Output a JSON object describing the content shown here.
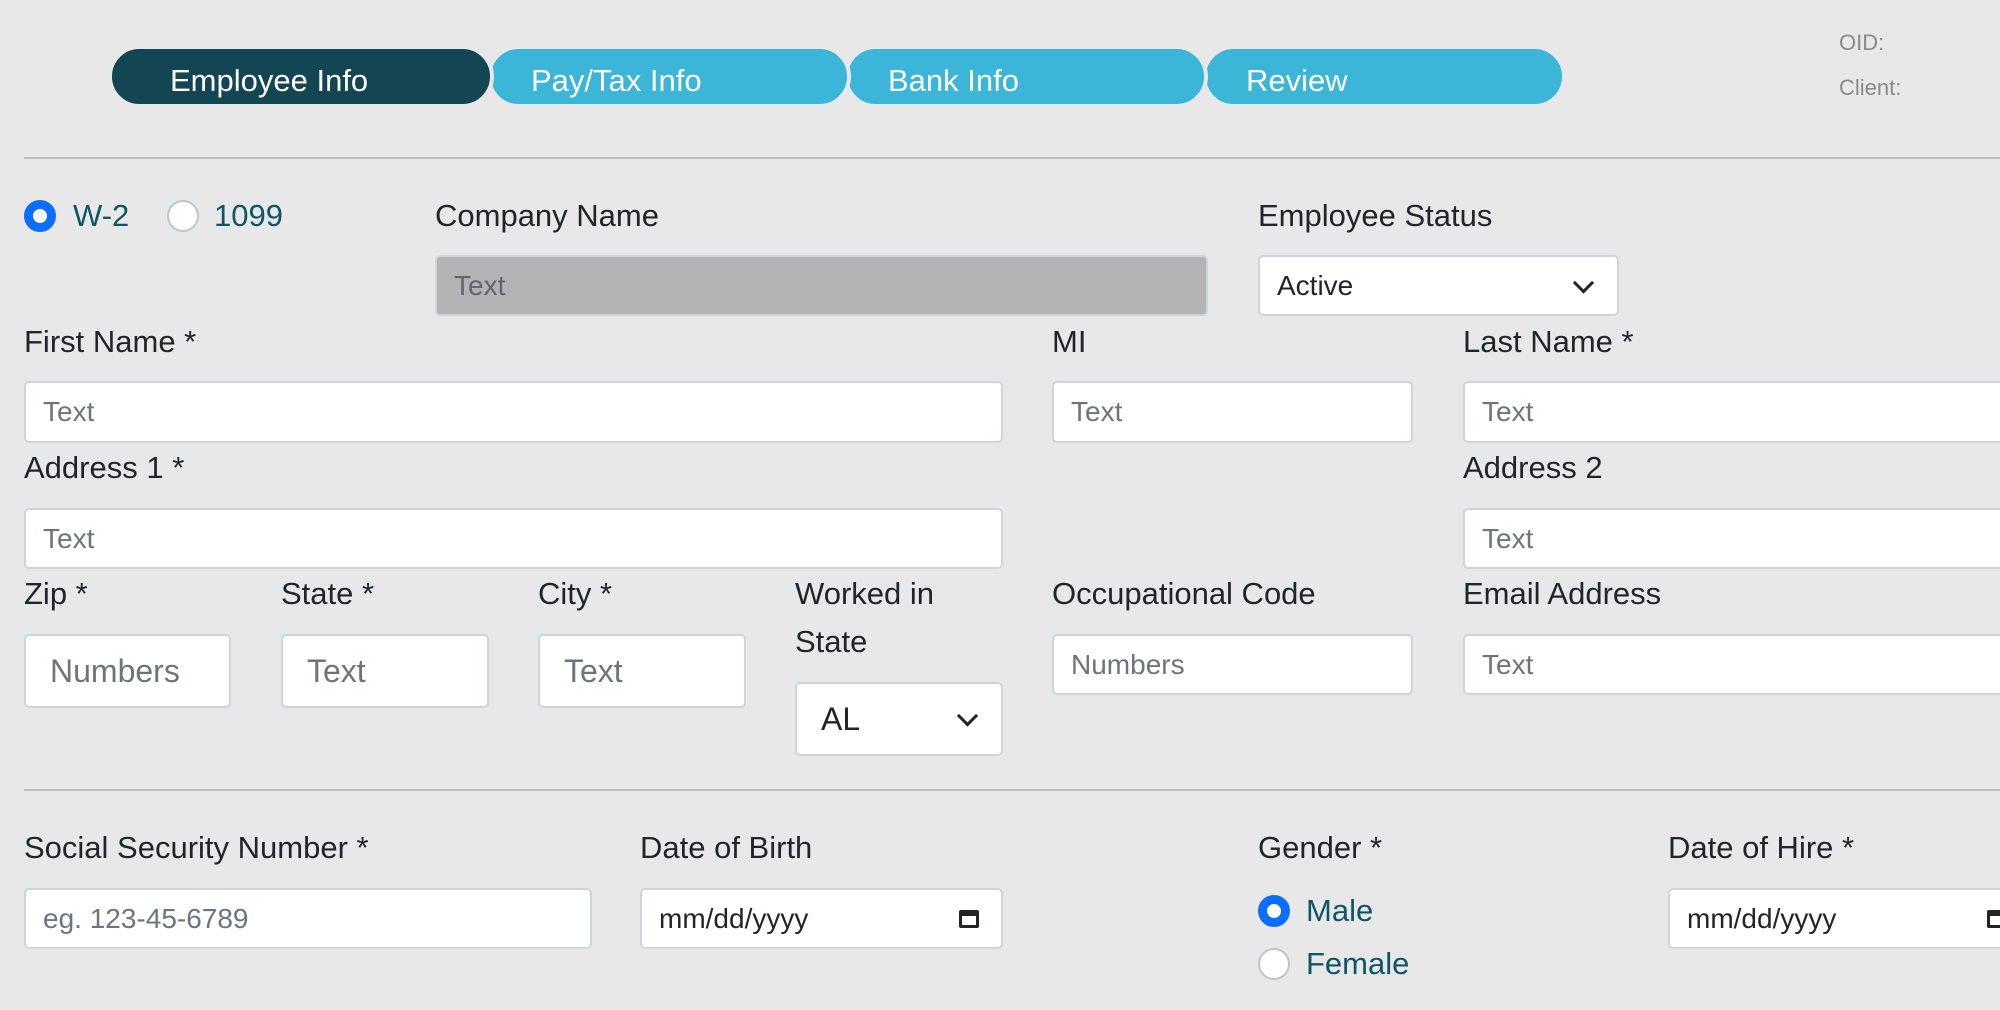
{
  "steps": [
    {
      "label": "Employee Info",
      "active": true
    },
    {
      "label": "Pay/Tax Info",
      "active": false
    },
    {
      "label": "Bank Info",
      "active": false
    },
    {
      "label": "Review",
      "active": false
    }
  ],
  "meta": {
    "oid_label": "OID:",
    "client_label": "Client:"
  },
  "colors": {
    "active_step": "#134552",
    "step": "#3bb5d8",
    "radio_checked": "#0d6efd",
    "radio_label": "#0e5566",
    "background": "#e8e8e8"
  },
  "form": {
    "worker_type": {
      "options": [
        "W-2",
        "1099"
      ],
      "selected": "W-2"
    },
    "company_name": {
      "label": "Company Name",
      "placeholder": "Text",
      "disabled": true
    },
    "employee_status": {
      "label": "Employee Status",
      "value": "Active"
    },
    "first_name": {
      "label": "First Name *",
      "placeholder": "Text"
    },
    "mi": {
      "label": "MI",
      "placeholder": "Text"
    },
    "last_name": {
      "label": "Last Name *",
      "placeholder": "Text"
    },
    "address1": {
      "label": "Address 1 *",
      "placeholder": "Text"
    },
    "address2": {
      "label": "Address 2",
      "placeholder": "Text"
    },
    "zip": {
      "label": "Zip *",
      "placeholder": "Numbers"
    },
    "state": {
      "label": "State *",
      "placeholder": "Text"
    },
    "city": {
      "label": "City *",
      "placeholder": "Text"
    },
    "worked_in_state": {
      "label_line1": "Worked in",
      "label_line2": "State",
      "value": "AL"
    },
    "occupational_code": {
      "label": "Occupational Code",
      "placeholder": "Numbers"
    },
    "email": {
      "label": "Email Address",
      "placeholder": "Text"
    },
    "ssn": {
      "label": "Social Security Number *",
      "placeholder": "eg. 123-45-6789"
    },
    "dob": {
      "label": "Date of Birth",
      "value": "mm/dd/yyyy"
    },
    "gender": {
      "label": "Gender *",
      "options": [
        "Male",
        "Female"
      ],
      "selected": "Male"
    },
    "hire_date": {
      "label": "Date of Hire *",
      "value": "mm/dd/yyyy"
    }
  }
}
